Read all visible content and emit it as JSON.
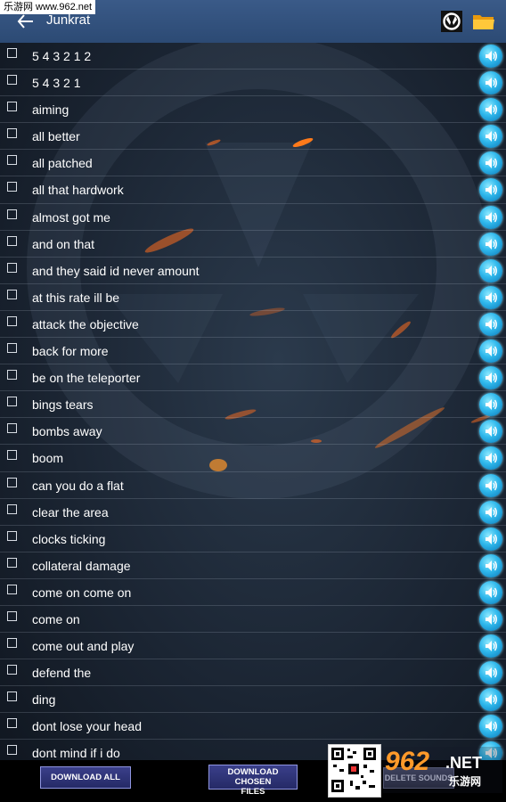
{
  "watermark": "乐游网 www.962.net",
  "header": {
    "title": "Junkrat",
    "back_icon": "arrow-left-icon",
    "overwatch_icon": "overwatch-logo-icon",
    "folder_icon": "folder-icon"
  },
  "items": [
    {
      "label": "5 4 3 2 1 2"
    },
    {
      "label": "5 4 3 2 1"
    },
    {
      "label": "aiming"
    },
    {
      "label": "all better"
    },
    {
      "label": "all patched"
    },
    {
      "label": "all that hardwork"
    },
    {
      "label": "almost got me"
    },
    {
      "label": "and on that"
    },
    {
      "label": "and they said id never amount"
    },
    {
      "label": "at this rate ill be"
    },
    {
      "label": "attack the objective"
    },
    {
      "label": "back for more"
    },
    {
      "label": "be on the teleporter"
    },
    {
      "label": "bings tears"
    },
    {
      "label": "bombs away"
    },
    {
      "label": "boom"
    },
    {
      "label": "can you do a flat"
    },
    {
      "label": "clear the area"
    },
    {
      "label": "clocks ticking"
    },
    {
      "label": "collateral damage"
    },
    {
      "label": "come on come on"
    },
    {
      "label": "come on"
    },
    {
      "label": "come out and play"
    },
    {
      "label": "defend the"
    },
    {
      "label": "ding"
    },
    {
      "label": "dont lose your head"
    },
    {
      "label": "dont mind if i do"
    }
  ],
  "footer": {
    "download_all": "DOWNLOAD ALL",
    "download_chosen_line1": "DOWNLOAD CHOSEN",
    "download_chosen_line2": "FILES",
    "delete_sounds": "DELETE SOUNDS"
  },
  "brand": {
    "number": "962",
    "net": ".NET",
    "cn": "乐游网"
  },
  "colors": {
    "header": "#2c4a74",
    "play_button": "#2fb8ec",
    "button_bg": "#252a66"
  }
}
